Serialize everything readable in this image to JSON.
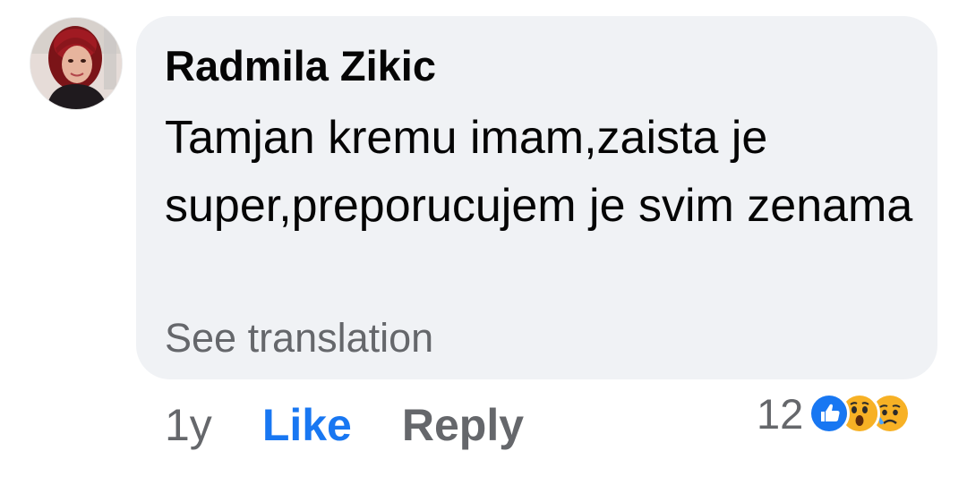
{
  "comment": {
    "author": "Radmila Zikic",
    "text": "Tamjan kremu imam,zaista je super,preporucujem je svim zenama",
    "translation_link": "See translation",
    "time": "1y",
    "like_label": "Like",
    "reply_label": "Reply",
    "reaction_count": "12",
    "reaction_icons": [
      "like-icon",
      "wow-icon",
      "sad-icon"
    ]
  },
  "colors": {
    "bubble": "#f0f2f5",
    "like_blue": "#1877f2",
    "secondary_text": "#65676b",
    "primary_text": "#050505"
  }
}
